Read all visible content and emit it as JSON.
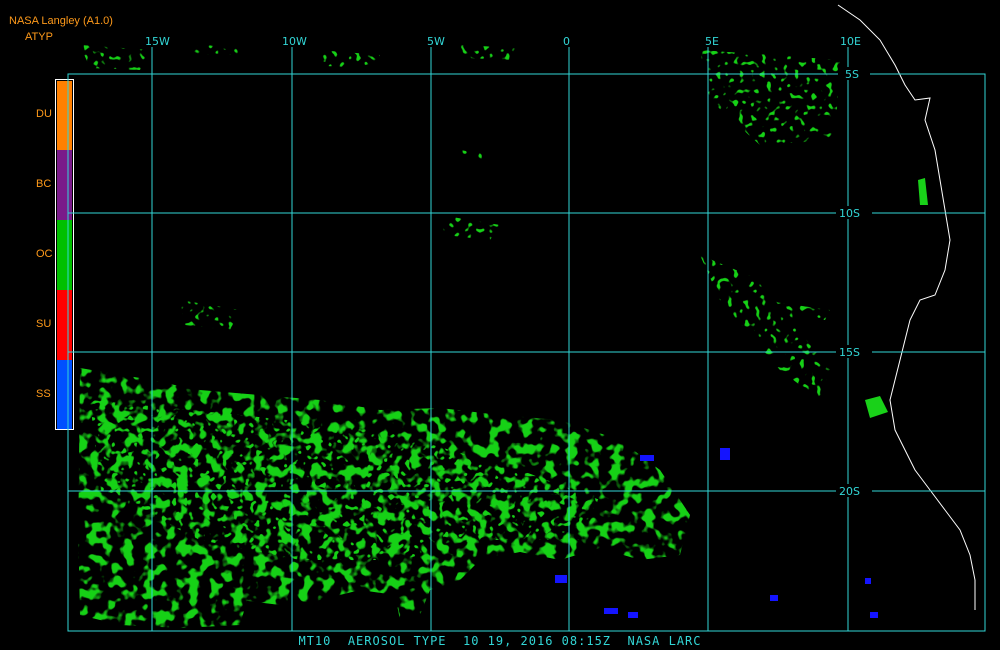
{
  "header": {
    "title": "NASA Langley (A1.0)",
    "product": "ATYP"
  },
  "legend": [
    {
      "label": "DU",
      "color": "#ff8000"
    },
    {
      "label": "BC",
      "color": "#7a1a8a"
    },
    {
      "label": "OC",
      "color": "#00c000"
    },
    {
      "label": "SU",
      "color": "#ff0000"
    },
    {
      "label": "SS",
      "color": "#0050ff"
    }
  ],
  "grid": {
    "longitude_labels": [
      "15W",
      "10W",
      "5W",
      "0",
      "5E",
      "10E"
    ],
    "latitude_labels": [
      "5S",
      "10S",
      "15S",
      "20S"
    ]
  },
  "colors": {
    "grid": "#32d6d6",
    "coast": "#ffffff",
    "oc": "#19d119",
    "ss": "#1414ff"
  },
  "footer": "MT10  AEROSOL TYPE  10 19, 2016 08:15Z  NASA LARC"
}
